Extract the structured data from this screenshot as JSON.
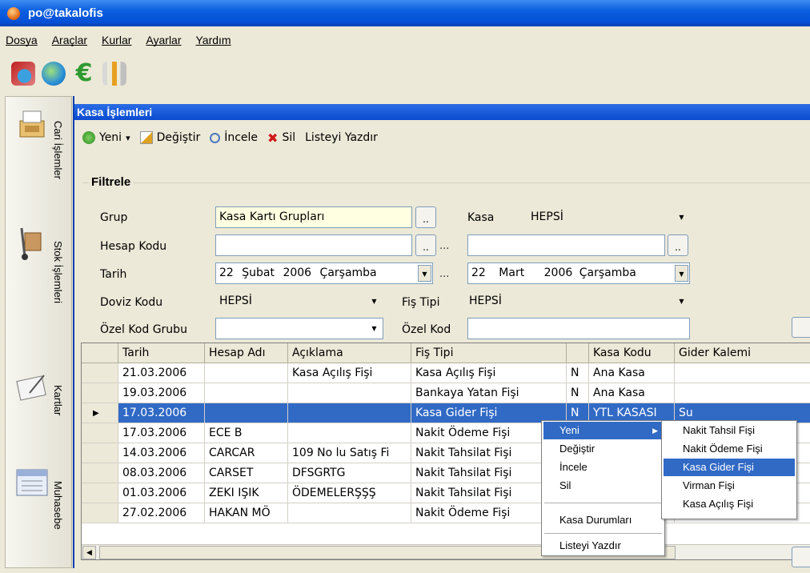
{
  "window": {
    "title": "po@takalofis"
  },
  "menu": [
    "Dosya",
    "Araçlar",
    "Kurlar",
    "Ayarlar",
    "Yardım"
  ],
  "toolbar_icons": [
    "tools-world-icon",
    "globe-icon",
    "euro-icon",
    "wrench-icon"
  ],
  "leftnav": [
    {
      "label": "Cari İşlemler",
      "icon": "cash-register-icon"
    },
    {
      "label": "Stok İşlemleri",
      "icon": "hand-truck-icon"
    },
    {
      "label": "Kartlar",
      "icon": "notepad-icon"
    },
    {
      "label": "Muhasebe",
      "icon": "accounts-book-icon"
    }
  ],
  "panel": {
    "title": "Kasa İşlemleri",
    "actions": {
      "new": "Yeni",
      "new_arrow": "▾",
      "edit": "Değiştir",
      "view": "İncele",
      "delete": "Sil",
      "print": "Listeyi Yazdır"
    }
  },
  "filter": {
    "legend": "Filtrele",
    "group_label": "Grup",
    "group_value": "Kasa Kartı Grupları",
    "kasa_label": "Kasa",
    "kasa_value": "HEPSİ",
    "account_label": "Hesap Kodu",
    "account_from": "",
    "account_to": "",
    "date_label": "Tarih",
    "date_from": {
      "day": "22",
      "month": "Şubat",
      "year": "2006",
      "weekday": "Çarşamba"
    },
    "date_to": {
      "day": "22",
      "month": "Mart",
      "year": "2006",
      "weekday": "Çarşamba"
    },
    "currency_label": "Doviz Kodu",
    "currency_value": "HEPSİ",
    "slip_type_label": "Fiş Tipi",
    "slip_type_value": "HEPSİ",
    "special_group_label": "Özel Kod Grubu",
    "special_group_value": "",
    "special_code_label": "Özel Kod",
    "special_code_value": "",
    "browse": "..",
    "range": "..."
  },
  "grid": {
    "columns": [
      "Tarih",
      "Hesap Adı",
      "Açıklama",
      "Fiş Tipi",
      "",
      "Kasa Kodu",
      "Gider Kalemi"
    ],
    "rows": [
      [
        "21.03.2006",
        "",
        "Kasa Açılış Fişi",
        "Kasa Açılış Fişi",
        "N",
        "Ana Kasa",
        ""
      ],
      [
        "19.03.2006",
        "",
        "",
        "Bankaya Yatan Fişi",
        "N",
        "Ana Kasa",
        ""
      ],
      [
        "17.03.2006",
        "",
        "",
        "Kasa Gider Fişi",
        "N",
        "YTL KASASI",
        "Su"
      ],
      [
        "17.03.2006",
        "ECE B",
        "",
        "Nakit Ödeme Fişi",
        "",
        "",
        ""
      ],
      [
        "14.03.2006",
        "CARCAR",
        "109 No lu Satış Fi",
        "Nakit Tahsilat Fişi",
        "",
        "",
        ""
      ],
      [
        "08.03.2006",
        "CARSET",
        "DFSGRTG",
        "Nakit Tahsilat Fişi",
        "",
        "",
        ""
      ],
      [
        "01.03.2006",
        "ZEKI IŞIK",
        "ÖDEMELERŞŞŞ",
        "Nakit Tahsilat Fişi",
        "",
        "",
        ""
      ],
      [
        "27.02.2006",
        "HAKAN MÖ",
        "",
        "Nakit Ödeme Fişi",
        "",
        "",
        ""
      ]
    ],
    "selected_row": 2,
    "row_pointer": "▶"
  },
  "context_menu": {
    "items": [
      "Yeni",
      "Değiştir",
      "İncele",
      "Sil",
      "Kasa Durumları",
      "Listeyi Yazdır"
    ],
    "submenu_arrow": "▶",
    "submenu": [
      "Nakit Tahsil Fişi",
      "Nakit Ödeme Fişi",
      "Kasa Gider Fişi",
      "Virman Fişi",
      "Kasa Açılış Fişi"
    ],
    "active_item": "Yeni",
    "active_submenu_item": "Kasa Gider Fişi"
  },
  "colors": {
    "selection": "#316ac5",
    "titlebar": "#0a5fe0",
    "highlight_field": "#ffffe1"
  }
}
